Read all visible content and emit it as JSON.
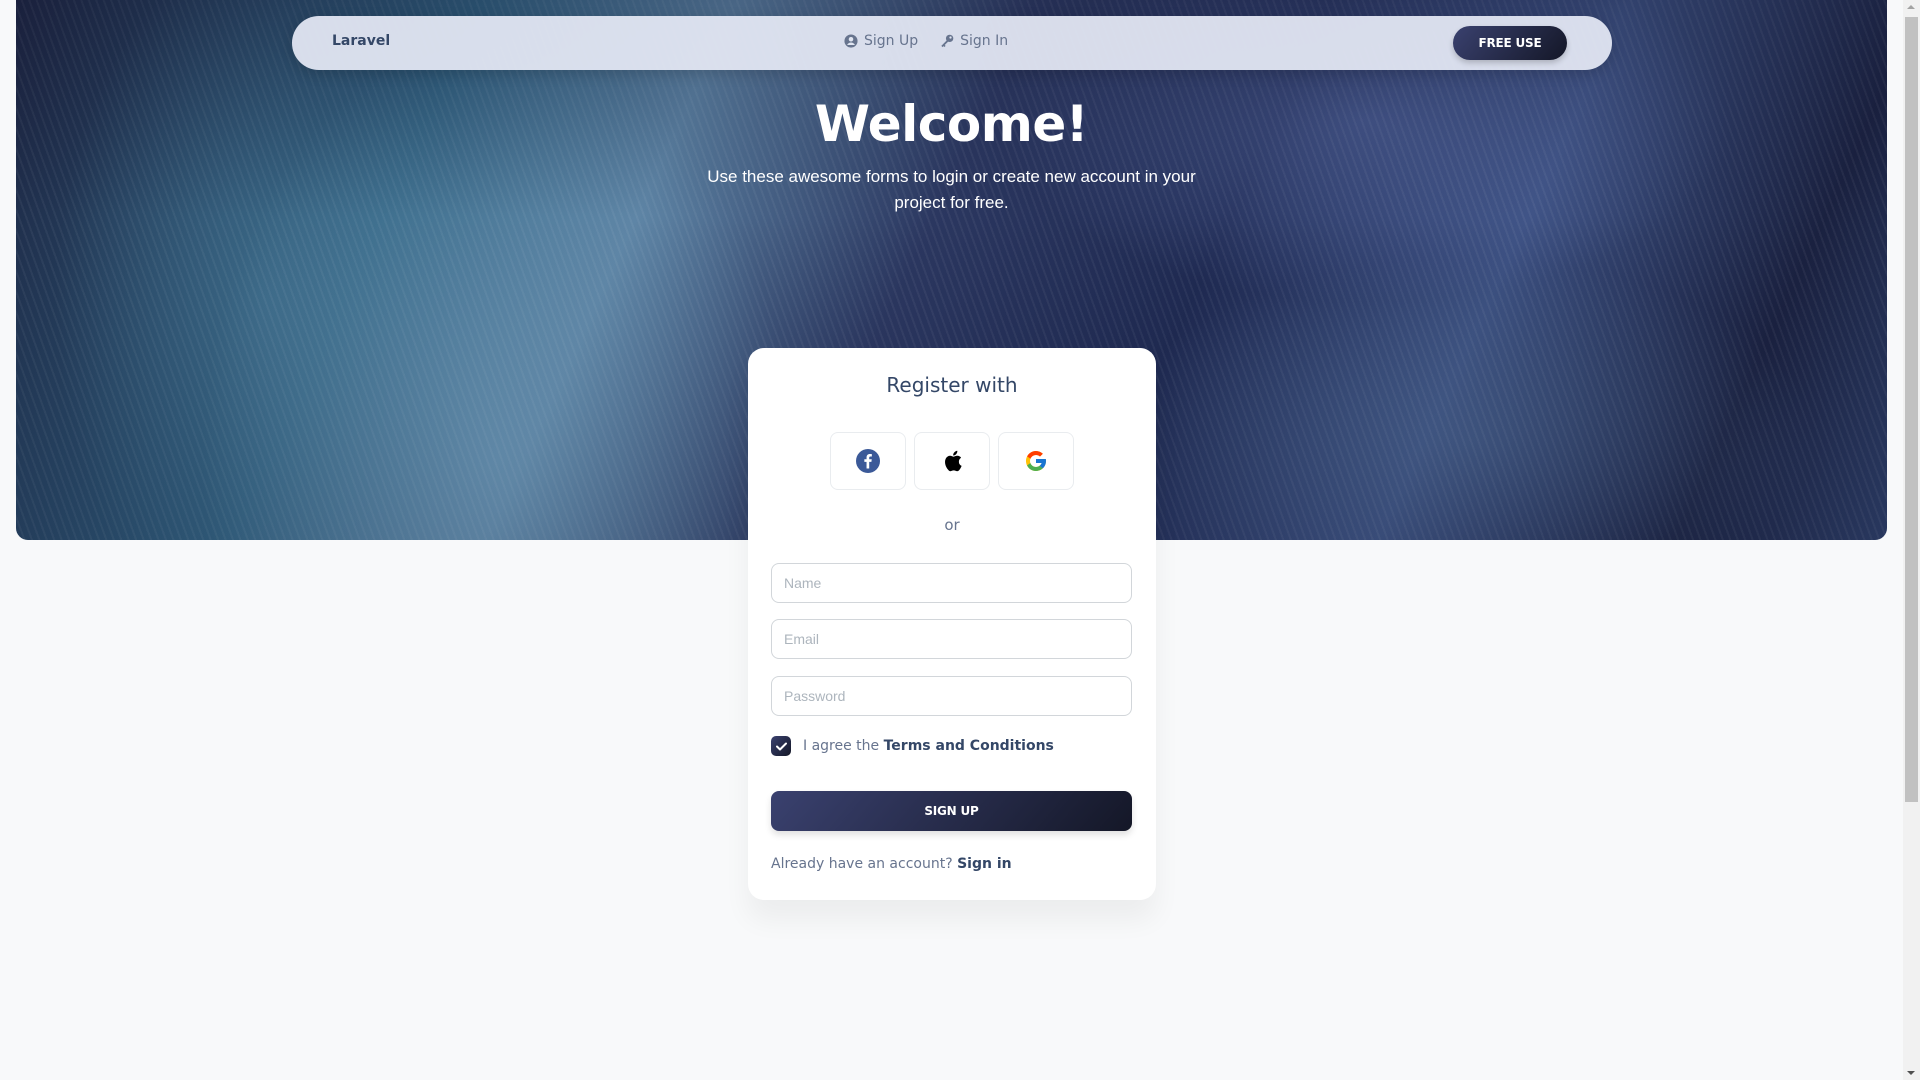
{
  "navbar": {
    "brand": "Laravel",
    "links": [
      {
        "label": "Sign Up",
        "icon": "user-circle-icon"
      },
      {
        "label": "Sign In",
        "icon": "key-icon"
      }
    ],
    "cta_label": "FREE USE"
  },
  "hero": {
    "title": "Welcome!",
    "subtitle": "Use these awesome forms to login or create new account in your project for free."
  },
  "card": {
    "title": "Register with",
    "social_buttons": [
      {
        "name": "facebook",
        "icon": "facebook-icon",
        "color": "#3b5998"
      },
      {
        "name": "apple",
        "icon": "apple-icon",
        "color": "#000000"
      },
      {
        "name": "google",
        "icon": "google-icon",
        "color": "#4285f4"
      }
    ],
    "divider_text": "or",
    "fields": {
      "name": {
        "placeholder": "Name",
        "value": ""
      },
      "email": {
        "placeholder": "Email",
        "value": ""
      },
      "password": {
        "placeholder": "Password",
        "value": ""
      }
    },
    "agree": {
      "checked": true,
      "prefix": "I agree the",
      "link": "Terms and Conditions"
    },
    "submit_label": "SIGN UP",
    "footer": {
      "text": "Already have an account?",
      "link": "Sign in"
    }
  },
  "colors": {
    "primary_gradient_start": "#3a416f",
    "primary_gradient_end": "#141727",
    "text_heading": "#344767",
    "text_muted": "#67748e"
  }
}
